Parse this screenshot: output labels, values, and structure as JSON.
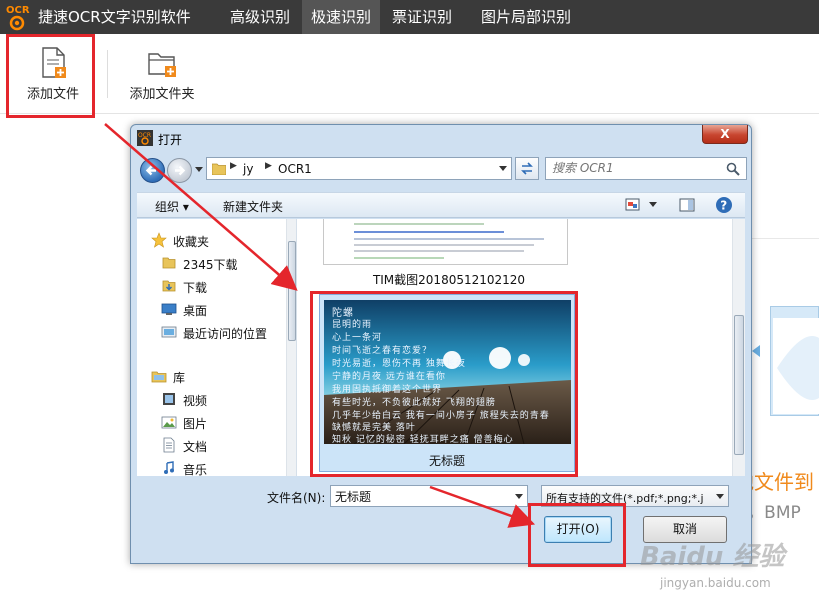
{
  "app": {
    "logo_text": "OCR",
    "title": "捷速OCR文字识别软件",
    "tabs": [
      "高级识别",
      "极速识别",
      "票证识别",
      "图片局部识别"
    ],
    "active_tab": "极速识别",
    "accent_color": "#e4262c",
    "title_bar_color": "#3a3a3a"
  },
  "toolbar": {
    "add_file_label": "添加文件",
    "add_folder_label": "添加文件夹",
    "add_file_icon": "file-add-icon",
    "add_folder_icon": "folder-add-icon"
  },
  "background": {
    "orange_text": "地文件到",
    "gray_text": "G，BMP"
  },
  "dialog": {
    "title": "打开",
    "close_label": "X",
    "breadcrumb": [
      "jy",
      "OCR1"
    ],
    "search_placeholder": "搜索 OCR1",
    "commands": {
      "organize_label": "组织",
      "new_folder_label": "新建文件夹"
    },
    "nav_pane": {
      "items": [
        {
          "label": "收藏夹",
          "icon": "star-icon"
        },
        {
          "label": "2345下载",
          "icon": "folder-icon"
        },
        {
          "label": "下载",
          "icon": "download-folder-icon"
        },
        {
          "label": "桌面",
          "icon": "desktop-icon"
        },
        {
          "label": "最近访问的位置",
          "icon": "recent-places-icon"
        },
        {
          "label": "库",
          "icon": "library-icon"
        },
        {
          "label": "视频",
          "icon": "video-icon"
        },
        {
          "label": "图片",
          "icon": "pictures-icon"
        },
        {
          "label": "文档",
          "icon": "documents-icon"
        },
        {
          "label": "音乐",
          "icon": "music-icon"
        }
      ]
    },
    "files": [
      {
        "name": "TIM截图20180512102120",
        "selected": false
      },
      {
        "name": "无标题",
        "selected": true
      }
    ],
    "preview_poem": [
      "陀螺",
      "昆明的雨",
      "心上一条河",
      "时间飞逝之春有恋爱？",
      "时光易逝，恩伤不再 独舞长夜",
      "宁静的月夜 远方谁在看你",
      "我用固执抵御着这个世界",
      "有些时光，不负彼此就好 飞翔的翅膀",
      "几乎年少给白云 我有一间小房子 旅程失去的青春",
      "缺憾就是完美 落叶",
      "知秋 记忆的秘密 轻抚耳畔之痛 僧善梅心"
    ],
    "filename_label": "文件名(N):",
    "filename_value": "无标题",
    "filetype_value": "所有支持的文件(*.pdf;*.png;*.j",
    "open_label": "打开(O)",
    "cancel_label": "取消"
  },
  "watermark": {
    "logo": "Baidu 经验",
    "url": "jingyan.baidu.com"
  }
}
